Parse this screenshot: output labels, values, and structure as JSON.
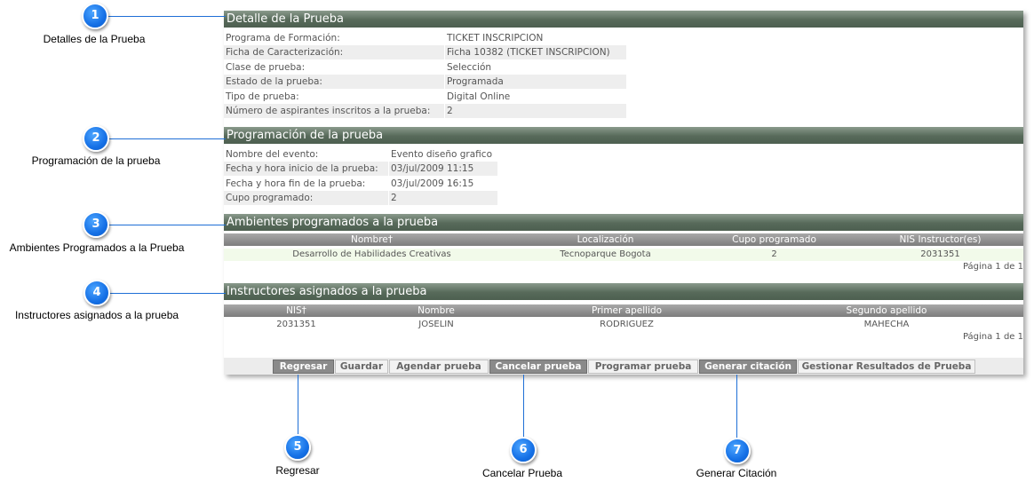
{
  "sections": {
    "detalle": {
      "title": "Detalle de la Prueba",
      "rows": [
        {
          "label": "Programa de Formación:",
          "value": "TICKET INSCRIPCION"
        },
        {
          "label": "Ficha de Caracterización:",
          "value": "Ficha 10382 (TICKET INSCRIPCION)"
        },
        {
          "label": "Clase de prueba:",
          "value": "Selección"
        },
        {
          "label": "Estado de la prueba:",
          "value": "Programada"
        },
        {
          "label": "Tipo de prueba:",
          "value": "Digital Online"
        },
        {
          "label": "Número de aspirantes inscritos a la prueba:",
          "value": "2"
        }
      ]
    },
    "programacion": {
      "title": "Programación de la prueba",
      "rows": [
        {
          "label": "Nombre del evento:",
          "value": "Evento diseño grafico"
        },
        {
          "label": "Fecha y hora inicio de la prueba:",
          "value": "03/jul/2009 11:15"
        },
        {
          "label": "Fecha y hora fin de la prueba:",
          "value": "03/jul/2009 16:15"
        },
        {
          "label": "Cupo programado:",
          "value": "2"
        }
      ]
    },
    "ambientes": {
      "title": "Ambientes programados a la prueba",
      "columns": [
        "Nombre†",
        "Localización",
        "Cupo programado",
        "NIS Instructor(es)"
      ],
      "rows": [
        [
          "Desarrollo de Habilidades Creativas",
          "Tecnoparque Bogota",
          "2",
          "2031351"
        ]
      ],
      "pager": "Página 1 de 1"
    },
    "instructores": {
      "title": "Instructores asignados a la prueba",
      "columns": [
        "NIS†",
        "Nombre",
        "Primer apellido",
        "Segundo apellido"
      ],
      "rows": [
        [
          "2031351",
          "JOSELIN",
          "RODRIGUEZ",
          "MAHECHA"
        ]
      ],
      "pager": "Página 1 de 1"
    }
  },
  "toolbar": {
    "buttons": [
      {
        "label": "Regresar"
      },
      {
        "label": "Guardar"
      },
      {
        "label": "Agendar prueba"
      },
      {
        "label": "Cancelar prueba"
      },
      {
        "label": "Programar prueba"
      },
      {
        "label": "Generar citación"
      },
      {
        "label": "Gestionar Resultados de Prueba"
      }
    ]
  },
  "callouts": [
    {
      "number": "1",
      "label": "Detalles de la Prueba"
    },
    {
      "number": "2",
      "label": "Programación de la prueba"
    },
    {
      "number": "3",
      "label": "Ambientes Programados a la Prueba"
    },
    {
      "number": "4",
      "label": "Instructores asignados a la prueba"
    },
    {
      "number": "5",
      "label": "Regresar"
    },
    {
      "number": "6",
      "label": "Cancelar Prueba"
    },
    {
      "number": "7",
      "label": "Generar Citación"
    }
  ],
  "colors": {
    "section_header": "#576a5a",
    "grid_header": "#8c8c8c",
    "callout": "#1570e6",
    "connector": "#1f6fd6",
    "button_dark": "#8a8a8a"
  }
}
